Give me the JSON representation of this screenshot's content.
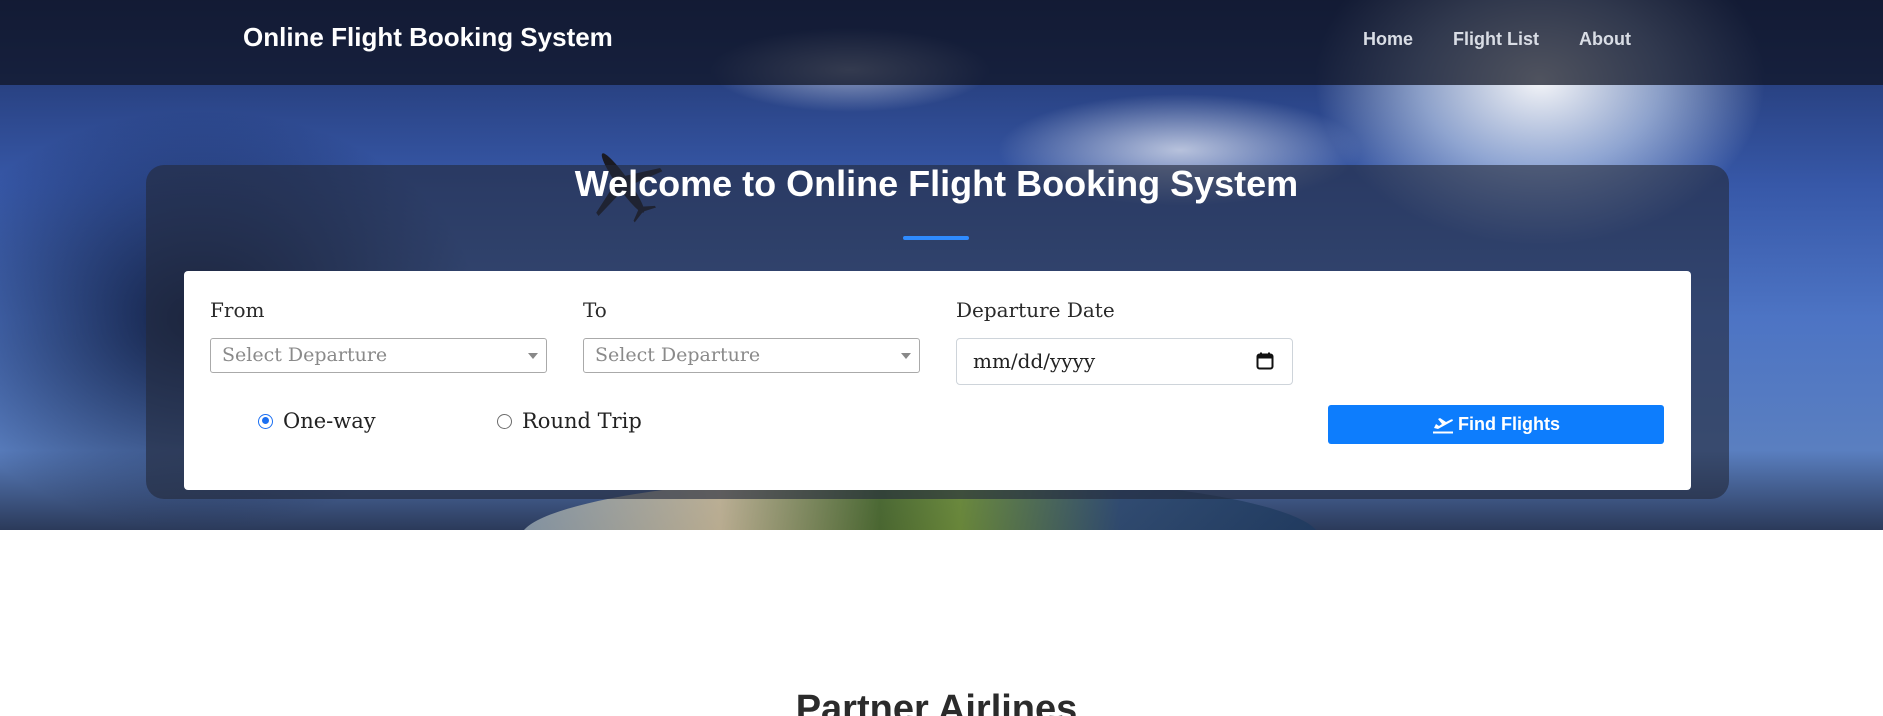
{
  "navbar": {
    "brand": "Online Flight Booking System",
    "links": [
      {
        "label": "Home"
      },
      {
        "label": "Flight List"
      },
      {
        "label": "About"
      }
    ]
  },
  "hero": {
    "title": "Welcome to Online Flight Booking System"
  },
  "search_form": {
    "from": {
      "label": "From",
      "placeholder": "Select Departure"
    },
    "to": {
      "label": "To",
      "placeholder": "Select Departure"
    },
    "departure_date": {
      "label": "Departure Date",
      "placeholder": "mm/dd/yyyy"
    },
    "trip_type": {
      "options": [
        {
          "label": "One-way",
          "checked": true
        },
        {
          "label": "Round Trip",
          "checked": false
        }
      ]
    },
    "submit_label": "Find Flights",
    "submit_icon": "plane-departure-icon"
  },
  "sections": {
    "partner_title": "Partner Airlines"
  },
  "colors": {
    "accent": "#0d7dfd",
    "radio_checked": "#1b6ff2",
    "underline": "#2f8bff"
  }
}
